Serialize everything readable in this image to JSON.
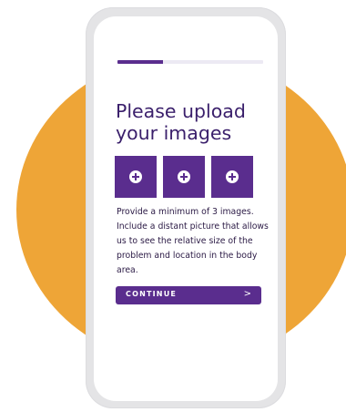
{
  "colors": {
    "accent": "#5a2d8e",
    "background_circle": "#eea537",
    "title": "#3a1f6b"
  },
  "progress": {
    "fraction": 0.31
  },
  "title": "Please upload your images",
  "upload_tiles": [
    {
      "icon": "plus-circle-icon"
    },
    {
      "icon": "plus-circle-icon"
    },
    {
      "icon": "plus-circle-icon"
    }
  ],
  "description": "Provide a minimum of 3 images. Include a distant picture that allows us to see the relative size of the problem and location in the body area.",
  "continue_button": {
    "label": "CONTINUE",
    "icon": "chevron-right-icon",
    "chevron": ">"
  }
}
